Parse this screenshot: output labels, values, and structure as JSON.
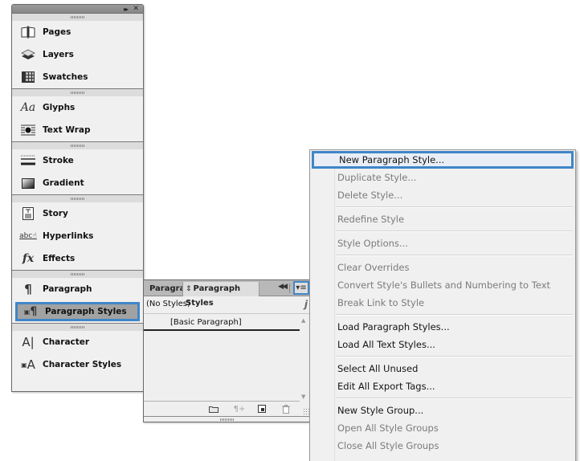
{
  "dock": {
    "titlebar": {
      "collapse_icon": "double-chevron-right-icon",
      "close_icon": "close-icon"
    },
    "groups": [
      {
        "items": [
          {
            "label": "Pages",
            "icon": "pages-icon"
          },
          {
            "label": "Layers",
            "icon": "layers-icon"
          },
          {
            "label": "Swatches",
            "icon": "swatches-icon"
          }
        ]
      },
      {
        "items": [
          {
            "label": "Glyphs",
            "icon": "glyphs-icon"
          },
          {
            "label": "Text Wrap",
            "icon": "text-wrap-icon"
          }
        ]
      },
      {
        "items": [
          {
            "label": "Stroke",
            "icon": "stroke-icon"
          },
          {
            "label": "Gradient",
            "icon": "gradient-icon"
          }
        ]
      },
      {
        "items": [
          {
            "label": "Story",
            "icon": "story-icon"
          },
          {
            "label": "Hyperlinks",
            "icon": "hyperlinks-icon"
          },
          {
            "label": "Effects",
            "icon": "effects-icon"
          }
        ]
      },
      {
        "items": [
          {
            "label": "Paragraph",
            "icon": "paragraph-icon"
          },
          {
            "label": "Paragraph Styles",
            "icon": "paragraph-styles-icon",
            "selected": true
          }
        ]
      },
      {
        "items": [
          {
            "label": "Character",
            "icon": "character-icon"
          },
          {
            "label": "Character Styles",
            "icon": "character-styles-icon"
          }
        ]
      }
    ]
  },
  "paragraph_styles_panel": {
    "tabs": [
      {
        "label": "Paragraph",
        "active": false
      },
      {
        "label": "Paragraph Styles",
        "active": true
      }
    ],
    "current_style": "(No Styles)",
    "styles": [
      "[Basic Paragraph]"
    ],
    "footer_buttons": [
      "new-style-group",
      "clear-overrides",
      "create-new-style",
      "delete-style"
    ]
  },
  "flyout_menu": {
    "sections": [
      [
        {
          "label": "New Paragraph Style...",
          "enabled": true,
          "highlighted": true
        },
        {
          "label": "Duplicate Style...",
          "enabled": false
        },
        {
          "label": "Delete Style...",
          "enabled": false
        }
      ],
      [
        {
          "label": "Redefine Style",
          "enabled": false
        }
      ],
      [
        {
          "label": "Style Options...",
          "enabled": false
        }
      ],
      [
        {
          "label": "Clear Overrides",
          "enabled": false
        },
        {
          "label": "Convert Style's Bullets and Numbering to Text",
          "enabled": false
        },
        {
          "label": "Break Link to Style",
          "enabled": false
        }
      ],
      [
        {
          "label": "Load Paragraph Styles...",
          "enabled": true
        },
        {
          "label": "Load All Text Styles...",
          "enabled": true
        }
      ],
      [
        {
          "label": "Select All Unused",
          "enabled": true
        },
        {
          "label": "Edit All Export Tags...",
          "enabled": true
        }
      ],
      [
        {
          "label": "New Style Group...",
          "enabled": true
        },
        {
          "label": "Open All Style Groups",
          "enabled": false
        },
        {
          "label": "Close All Style Groups",
          "enabled": false
        }
      ]
    ]
  },
  "colors": {
    "accent": "#3f86c8",
    "panel_bg": "#f0f0f0",
    "disabled_text": "#7b7b7b"
  }
}
